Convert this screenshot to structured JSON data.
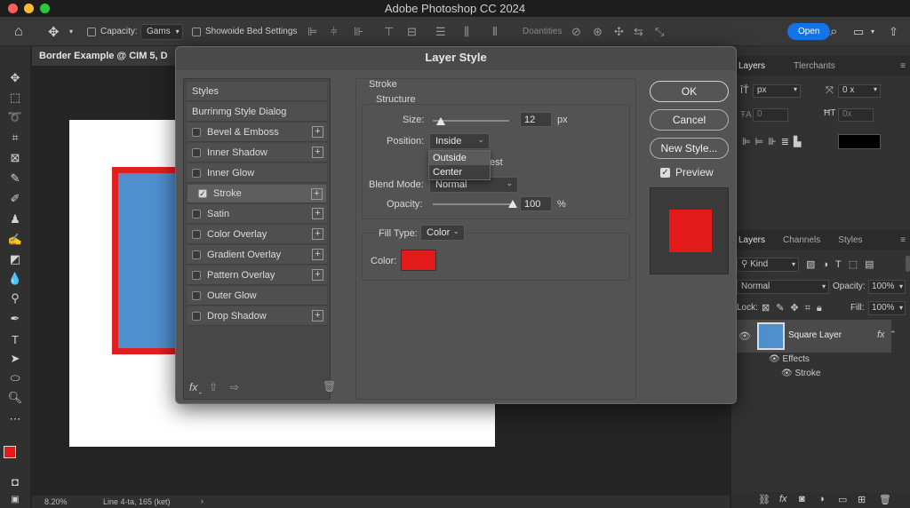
{
  "app": {
    "title": "Adobe Photoshop CC 2024"
  },
  "options": {
    "capacity_label": "Capacity:",
    "capacity_value": "Gams",
    "bed_settings_label": "Showoide Bed Settings",
    "quantities_label": "Doantities",
    "open_label": "Open"
  },
  "document": {
    "tab_title": "Border Example @ CIM 5, D",
    "zoom": "8.20%",
    "status": "Line 4-ta, 165 (ket)"
  },
  "dialog": {
    "title": "Layer Style",
    "styles_header": "Styles",
    "blending_item": "Burrinmg Style Dialog",
    "effects": [
      {
        "label": "Bevel & Emboss",
        "checked": false,
        "plus": true
      },
      {
        "label": "Inner Shadow",
        "checked": false,
        "plus": true
      },
      {
        "label": "Inner Glow",
        "checked": false,
        "plus": false
      },
      {
        "label": "Stroke",
        "checked": true,
        "plus": true
      },
      {
        "label": "Satin",
        "checked": false,
        "plus": true
      },
      {
        "label": "Color Overlay",
        "checked": false,
        "plus": true
      },
      {
        "label": "Gradient Overlay",
        "checked": false,
        "plus": true
      },
      {
        "label": "Pattern Overlay",
        "checked": false,
        "plus": true
      },
      {
        "label": "Outer Glow",
        "checked": false,
        "plus": false
      },
      {
        "label": "Drop Shadow",
        "checked": false,
        "plus": true
      }
    ],
    "stroke": {
      "section": "Stroke",
      "structure": "Structure",
      "size_label": "Size:",
      "size_value": "12",
      "size_unit": "px",
      "position_label": "Position:",
      "position_value": "Inside",
      "position_options": [
        "Outside",
        "Center"
      ],
      "partial_text": "est",
      "blend_label": "Blend Mode:",
      "blend_value": "Normal",
      "opacity_label": "Opacity:",
      "opacity_value": "100",
      "opacity_unit": "%",
      "size_fraction": 0.1,
      "opacity_fraction": 1.0,
      "fill_type_label": "Fill Type:",
      "fill_type_value": "Color",
      "color_label": "Color:",
      "color": "#e21a1a"
    },
    "buttons": {
      "ok": "OK",
      "cancel": "Cancel",
      "new_style": "New Style...",
      "preview": "Preview"
    },
    "preview_checked": true
  },
  "panels": {
    "top_tabs": [
      "Layers",
      "Tlerchants"
    ],
    "char": {
      "size_value": "px",
      "tracking_value": "0 x",
      "baseline_value": "0",
      "width_value": "0x",
      "color": "#000000"
    },
    "layer_tabs": [
      "Layers",
      "Channels",
      "Styles"
    ],
    "kind_label": "Kind",
    "blend_mode": "Normal",
    "opacity_label": "Opacity:",
    "opacity_value": "100%",
    "lock_label": "Lock:",
    "fill_label": "Fill:",
    "fill_value": "100%",
    "layer_name": "Square Layer",
    "effects_label": "Effects",
    "stroke_label": "Stroke"
  },
  "colors": {
    "foreground": "#e21a1a",
    "background": "#ffffff",
    "layer_fill": "#4f8fce"
  }
}
